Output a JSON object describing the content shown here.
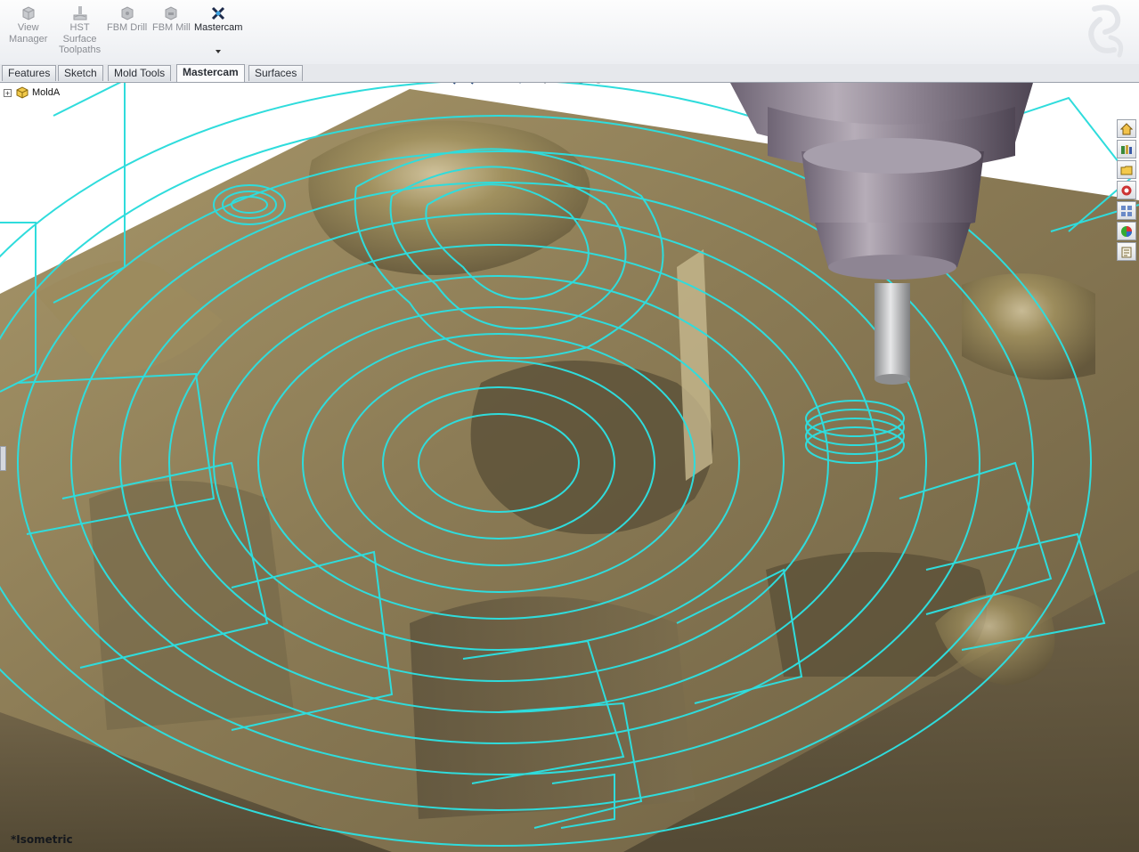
{
  "ribbon": {
    "buttons": [
      {
        "label": "View\nManager",
        "icon": "view-manager-icon",
        "enabled": false
      },
      {
        "label": "HST\nSurface\nToolpaths",
        "icon": "hst-surface-toolpaths-icon",
        "enabled": false
      },
      {
        "label": "FBM Drill",
        "icon": "fbm-drill-icon",
        "enabled": false
      },
      {
        "label": "FBM Mill",
        "icon": "fbm-mill-icon",
        "enabled": false
      },
      {
        "label": "Mastercam",
        "icon": "mastercam-icon",
        "enabled": true
      }
    ],
    "brand_logo": "ds-solidworks-logo"
  },
  "tabs": [
    {
      "label": "Features",
      "active": false
    },
    {
      "label": "Sketch",
      "active": false
    },
    {
      "label": "Mold Tools",
      "active": false
    },
    {
      "label": "Mastercam",
      "active": true
    },
    {
      "label": "Surfaces",
      "active": false
    }
  ],
  "tree": {
    "root_label": "MoldA",
    "expander": "+",
    "icon": "part-icon"
  },
  "heads_up_toolbar": [
    "zoom-to-fit-icon",
    "zoom-to-area-icon",
    "previous-view-icon",
    "section-view-icon",
    "view-orientation-icon",
    "display-style-icon",
    "hide-show-items-icon",
    "edit-appearance-icon",
    "apply-scene-icon",
    "view-settings-icon"
  ],
  "window_controls": {
    "minimize": "–",
    "restore": "⧉",
    "close": "✕"
  },
  "task_pane": [
    "solidworks-resources-icon",
    "design-library-icon",
    "file-explorer-icon",
    "search-icon",
    "view-palette-icon",
    "appearances-scenes-icon",
    "custom-properties-icon"
  ],
  "viewport": {
    "view_name": "*Isometric",
    "toolpath_color": "#2fdcdc",
    "part_color": "#8a7a55"
  }
}
